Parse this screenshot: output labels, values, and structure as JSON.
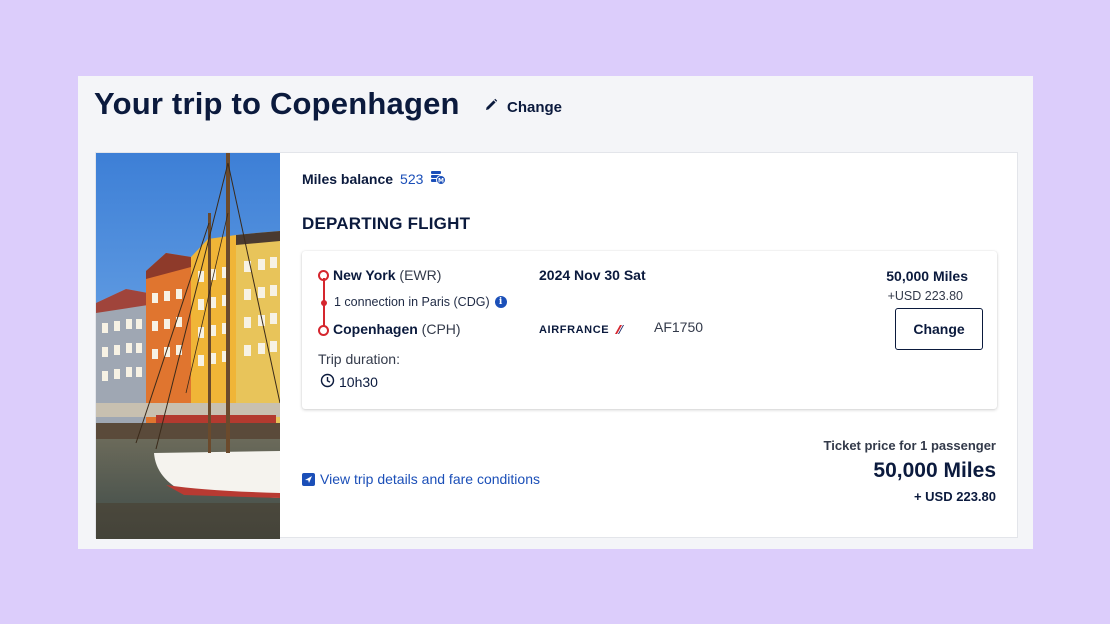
{
  "header": {
    "title": "Your trip to Copenhagen",
    "change_label": "Change"
  },
  "photo": {
    "icon": "nyhavn-harbor-photo"
  },
  "miles_balance": {
    "label": "Miles balance",
    "value": "523",
    "icon": "miles-wallet-icon"
  },
  "section": {
    "title": "DEPARTING FLIGHT"
  },
  "flight": {
    "origin_city": "New York",
    "origin_code": "(EWR)",
    "connection": "1 connection in Paris (CDG)",
    "destination_city": "Copenhagen",
    "destination_code": "(CPH)",
    "duration_label": "Trip duration:",
    "duration_value": "10h30",
    "date": "2024 Nov 30 Sat",
    "airline": "AIRFRANCE",
    "flight_number": "AF1750",
    "price_miles": "50,000 Miles",
    "price_usd": "+USD 223.80",
    "change_label": "Change"
  },
  "footer": {
    "details_link": "View trip details and fare conditions",
    "ticket_label": "Ticket price for 1 passenger",
    "total_miles": "50,000 Miles",
    "total_usd": "+ USD 223.80"
  },
  "colors": {
    "background": "#dccdfb",
    "navy": "#0b1a3d",
    "link_blue": "#1b4fb8",
    "route_red": "#d5262e"
  }
}
